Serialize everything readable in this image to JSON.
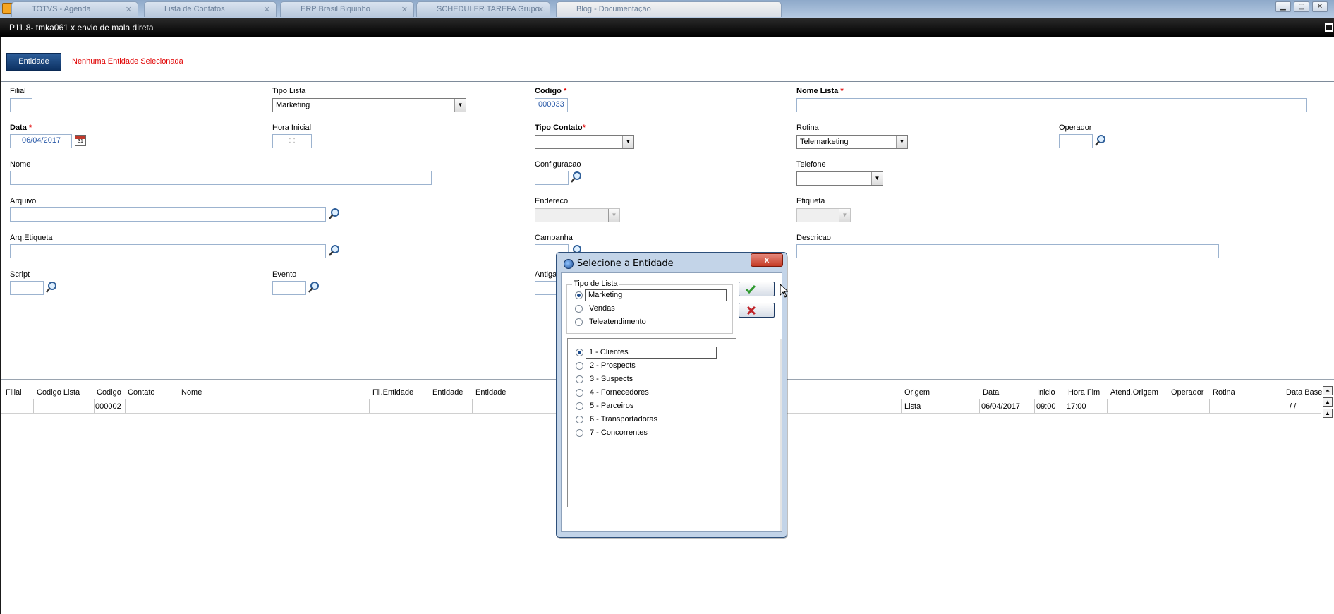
{
  "browser": {
    "tabs": [
      {
        "title": "TOTVS - Agenda"
      },
      {
        "title": "Lista de Contatos"
      },
      {
        "title": "ERP Brasil Biquinho"
      },
      {
        "title": "SCHEDULER TAREFA Grupo..."
      },
      {
        "title": "Blog - Documentação"
      }
    ]
  },
  "window": {
    "title": "P11.8- tmka061 x envio de mala direta"
  },
  "entity_bar": {
    "button": "Entidade",
    "message": "Nenhuma Entidade Selecionada"
  },
  "form": {
    "filial": {
      "label": "Filial",
      "value": ""
    },
    "tipo_lista": {
      "label": "Tipo Lista",
      "value": "Marketing"
    },
    "codigo": {
      "label": "Codigo",
      "req": "*",
      "value": "000033"
    },
    "nome_lista": {
      "label": "Nome Lista",
      "req": "*",
      "value": ""
    },
    "data": {
      "label": "Data",
      "req": "*",
      "value": "06/04/2017"
    },
    "hora_inicial": {
      "label": "Hora Inicial",
      "value": ": :"
    },
    "tipo_contato": {
      "label": "Tipo Contato",
      "req": "*",
      "value": ""
    },
    "rotina": {
      "label": "Rotina",
      "value": "Telemarketing"
    },
    "operador": {
      "label": "Operador",
      "value": ""
    },
    "nome": {
      "label": "Nome",
      "value": ""
    },
    "configuracao": {
      "label": "Configuracao",
      "value": ""
    },
    "telefone": {
      "label": "Telefone",
      "value": ""
    },
    "arquivo": {
      "label": "Arquivo",
      "value": ""
    },
    "endereco": {
      "label": "Endereco",
      "value": ""
    },
    "etiqueta": {
      "label": "Etiqueta",
      "value": ""
    },
    "arq_etiqueta": {
      "label": "Arq.Etiqueta",
      "value": ""
    },
    "campanha": {
      "label": "Campanha",
      "value": ""
    },
    "descricao": {
      "label": "Descricao",
      "value": ""
    },
    "script": {
      "label": "Script",
      "value": ""
    },
    "evento": {
      "label": "Evento",
      "value": ""
    },
    "antiga": {
      "label": "Antiga",
      "value": ""
    }
  },
  "grid": {
    "columns": [
      "Filial",
      "Codigo Lista",
      "Codigo",
      "Contato",
      "Nome",
      "Fil.Entidade",
      "Entidade",
      "Entidade",
      "Origem",
      "Data",
      "Inicio",
      "Hora Fim",
      "Atend.Origem",
      "Operador",
      "Rotina",
      "Data Base"
    ],
    "row": {
      "codigo": "000002",
      "origem": "Lista",
      "data": "06/04/2017",
      "inicio": "09:00",
      "hora_fim": "17:00",
      "data_base": "/ /"
    }
  },
  "dialog": {
    "title": "Selecione a Entidade",
    "close": "x",
    "tipo_group_label": "Tipo de Lista",
    "tipo_options": [
      "Marketing",
      "Vendas",
      "Teleatendimento"
    ],
    "tipo_selected": "Marketing",
    "entity_options": [
      "1 - Clientes",
      "2 - Prospects",
      "3 - Suspects",
      "4 - Fornecedores",
      "5 - Parceiros",
      "6 - Transportadoras",
      "7 - Concorrentes"
    ],
    "entity_selected": "1 - Clientes"
  },
  "icons": {
    "lookup": "magnifier-icon",
    "calendar": "calendar-icon",
    "confirm": "check-icon",
    "cancel": "cross-icon"
  },
  "colors": {
    "accent": "#0d3263",
    "required": "#e00000",
    "field_value": "#2a5aa8"
  }
}
